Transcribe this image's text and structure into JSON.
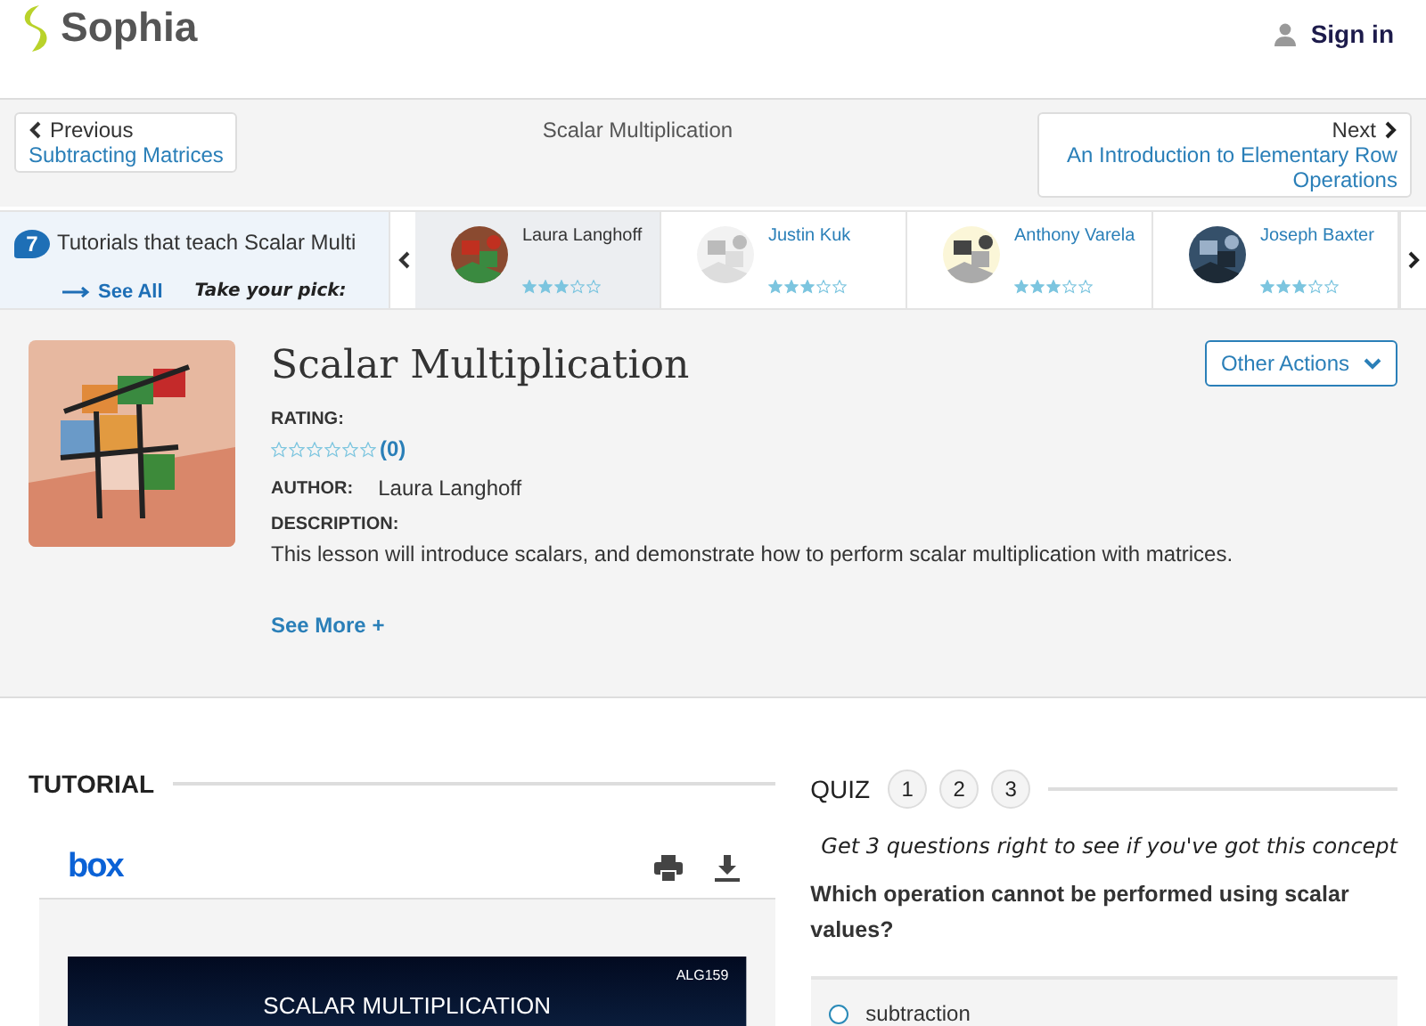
{
  "header": {
    "logo": "Sophia",
    "sign_in": "Sign in"
  },
  "lesson_nav": {
    "previous": {
      "label": "Previous",
      "title": "Subtracting Matrices"
    },
    "current": "Scalar Multiplication",
    "next": {
      "label": "Next",
      "title": "An Introduction to Elementary Row Operations"
    }
  },
  "tutorials_strip": {
    "count": "7",
    "title": "Tutorials that teach Scalar Multi",
    "see_all": "See All",
    "tagline": "Take your pick:",
    "items": [
      {
        "author": "Laura Langhoff",
        "stars": 3,
        "selected": true
      },
      {
        "author": "Justin Kuk",
        "stars": 3,
        "selected": false
      },
      {
        "author": "Anthony Varela",
        "stars": 3,
        "selected": false
      },
      {
        "author": "Joseph Baxter",
        "stars": 3,
        "selected": false
      }
    ]
  },
  "lesson": {
    "title": "Scalar Multiplication",
    "other_actions": "Other Actions",
    "rating_label": "RATING:",
    "stars": 0,
    "rating_count": "(0)",
    "author_label": "AUTHOR:",
    "author": "Laura Langhoff",
    "description_label": "DESCRIPTION:",
    "description": "This lesson will introduce scalars, and demonstrate how to perform scalar multiplication with matrices.",
    "see_more": "See More +"
  },
  "tutorial": {
    "heading": "TUTORIAL",
    "viewer": {
      "logo": "box",
      "slide_code": "ALG159",
      "slide_title": "SCALAR MULTIPLICATION"
    }
  },
  "quiz": {
    "heading": "QUIZ",
    "steps": [
      "1",
      "2",
      "3"
    ],
    "tagline": "Get 3 questions right to see if you've got this concept",
    "question": "Which operation cannot be performed using scalar values?",
    "options": [
      {
        "label": "subtraction",
        "selected": false
      }
    ]
  }
}
